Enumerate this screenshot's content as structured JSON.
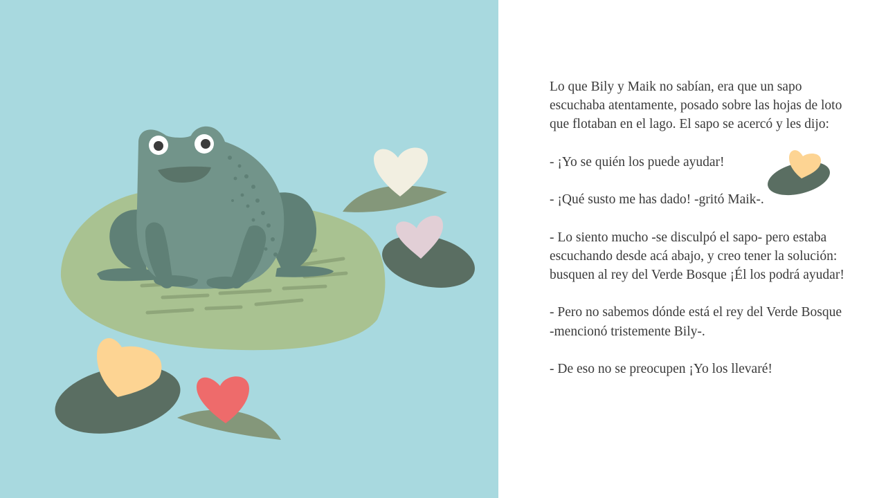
{
  "illustration": {
    "background_color": "#a8d9df",
    "subject": "frog-on-lily-pad",
    "colors": {
      "frog_body": "#72948a",
      "frog_shade": "#5f8076",
      "large_pad": "#a9c291",
      "dark_pad": "#5a6e62",
      "olive_pad": "#84977a",
      "heart_cream": "#f2efe1",
      "heart_pink": "#e2cfd6",
      "heart_yellow": "#fdd493",
      "heart_red": "#ee6b6b"
    }
  },
  "story": {
    "paragraphs": [
      "Lo que Bily y Maik no sabían, era que un sapo escuchaba atentamente, posado sobre las hojas de loto que flotaban en el lago. El sapo se acercó y les dijo:",
      "- ¡Yo se quién los puede ayudar!",
      "- ¡Qué susto me has dado! -gritó Maik-.",
      "- Lo siento mucho -se disculpó el sapo- pero estaba escuchando desde acá abajo, y creo tener la solución: busquen al rey del Verde Bosque ¡Él los podrá ayudar!",
      "- Pero no sabemos dónde está el rey del Verde Bosque -mencionó tristemente Bily-.",
      "- De eso no se preocupen ¡Yo los llevaré!"
    ]
  },
  "decoration": {
    "icon": "lily-pad-heart-icon",
    "heart_color": "#fdd493",
    "pad_color": "#5a6e62"
  }
}
